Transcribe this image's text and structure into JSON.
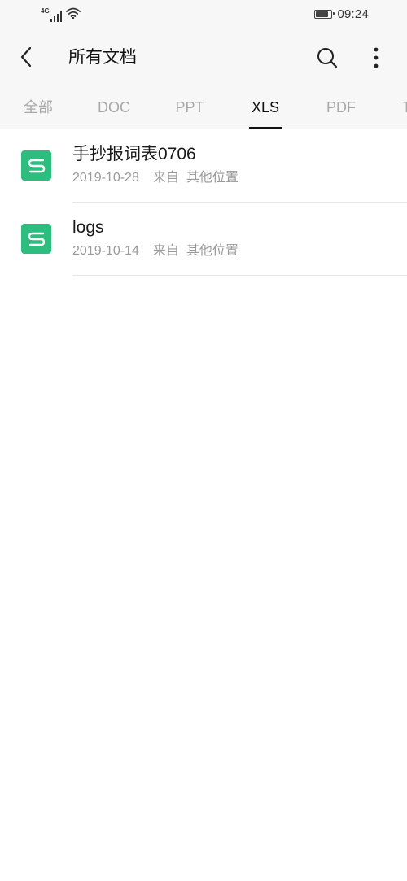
{
  "status_bar": {
    "network_type": "4G",
    "time": "09:24",
    "battery_level": 0.85
  },
  "header": {
    "title": "所有文档"
  },
  "tabs": [
    {
      "label": "全部",
      "active": false
    },
    {
      "label": "DOC",
      "active": false
    },
    {
      "label": "PPT",
      "active": false
    },
    {
      "label": "XLS",
      "active": true
    },
    {
      "label": "PDF",
      "active": false
    },
    {
      "label": "T",
      "active": false
    }
  ],
  "files": [
    {
      "name": "手抄报词表0706",
      "date": "2019-10-28",
      "from_label": "来自",
      "location": "其他位置",
      "icon": "xls-file-icon"
    },
    {
      "name": "logs",
      "date": "2019-10-14",
      "from_label": "来自",
      "location": "其他位置",
      "icon": "xls-file-icon"
    }
  ],
  "colors": {
    "xls_icon": "#2dbd7f",
    "active_tab": "#111111",
    "inactive_tab": "#a8a8a8",
    "meta_text": "#9a9a9a"
  }
}
